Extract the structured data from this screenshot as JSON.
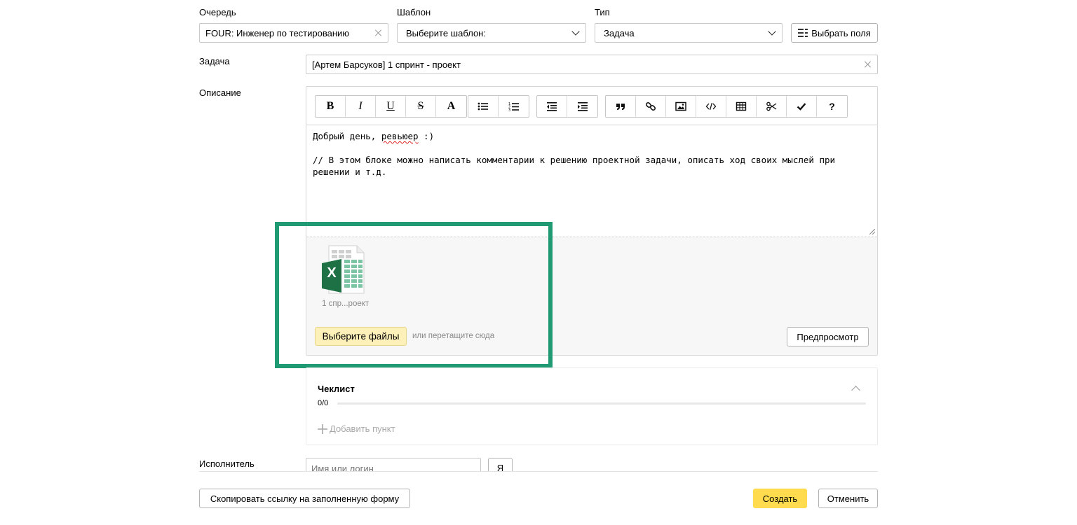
{
  "form": {
    "queue": {
      "label": "Очередь",
      "value": "FOUR: Инженер по тестированию"
    },
    "template": {
      "label": "Шаблон",
      "value": "Выберите шаблон:"
    },
    "type": {
      "label": "Тип",
      "value": "Задача"
    },
    "choose_fields_label": "Выбрать поля",
    "task": {
      "label": "Задача",
      "value": "[Артем Барсуков] 1 спринт - проект"
    },
    "description": {
      "label": "Описание",
      "line1_start": "Добрый день, ",
      "line1_word": "ревьюер",
      "line1_end": " :)",
      "line2": "// В этом блоке можно написать комментарии к решению проектной задачи, описать ход своих мыслей при",
      "line3": "решении и т.д."
    },
    "toolbar": {
      "bold": "B",
      "italic": "I",
      "underline": "U",
      "strike": "S",
      "text_color": "A",
      "help": "?"
    },
    "attachment": {
      "file_name": "1 спр...роект",
      "file_icon_letter": "X",
      "choose_files_label": "Выберите файлы",
      "drop_hint": "или перетащите сюда",
      "preview_label": "Предпросмотр"
    },
    "checklist": {
      "title": "Чеклист",
      "progress": "0/0",
      "add_item_label": "Добавить пункт"
    },
    "assignee": {
      "label": "Исполнитель",
      "placeholder": "Имя или логин",
      "me_button": "Я"
    }
  },
  "footer": {
    "copy_link_label": "Скопировать ссылку на заполненную форму",
    "create_label": "Создать",
    "cancel_label": "Отменить"
  },
  "colors": {
    "accent_yellow": "#ffdb4d",
    "highlight_green": "#1f9a72",
    "excel_green": "#1e7145"
  },
  "icons": [
    "close-icon",
    "chevron-down-icon",
    "fields-icon",
    "list-bullets-icon",
    "list-numbers-icon",
    "outdent-icon",
    "indent-icon",
    "quote-icon",
    "link-icon",
    "image-icon",
    "code-icon",
    "table-icon",
    "scissors-icon",
    "check-icon",
    "excel-file-icon",
    "plus-icon",
    "chevron-up-icon"
  ]
}
